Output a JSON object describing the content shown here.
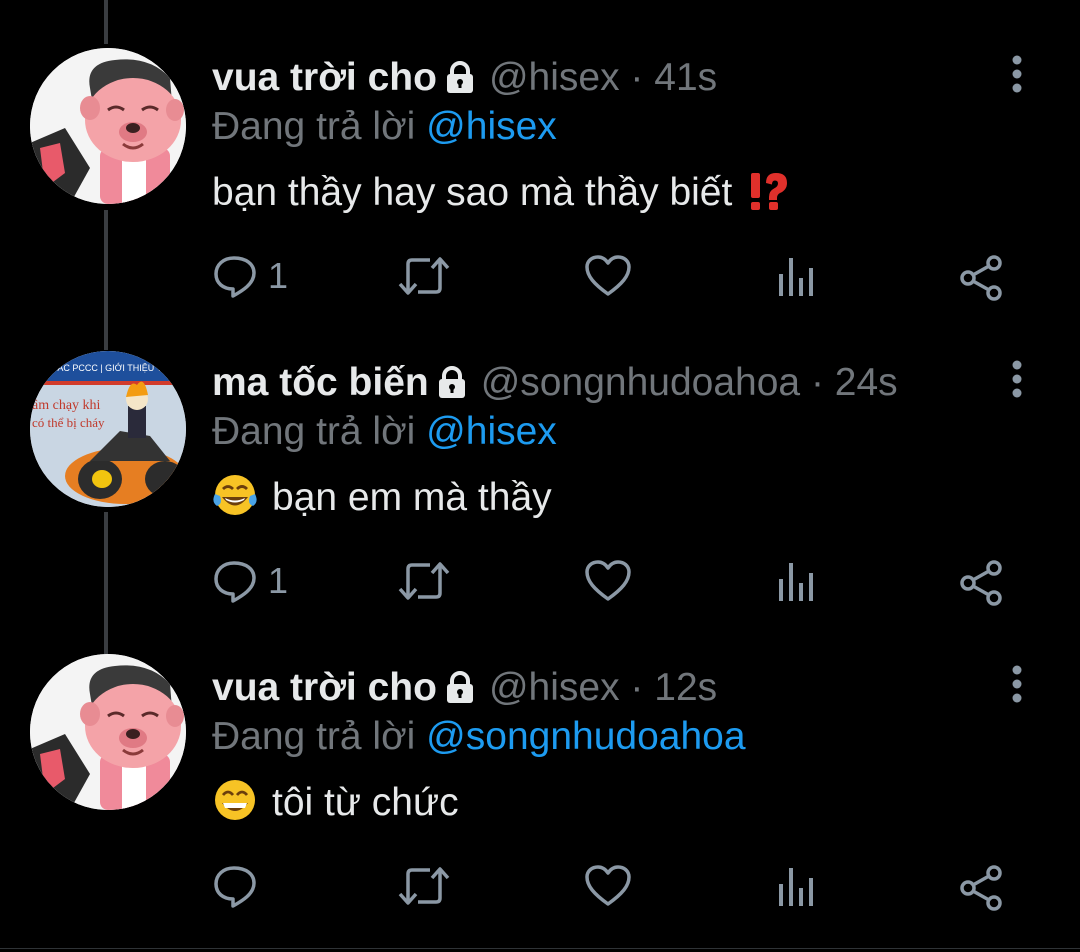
{
  "tweets": [
    {
      "name": "vua trời cho",
      "handle": "@hisex",
      "separator": "·",
      "time": "41s",
      "reply_prefix": "Đang trả lời",
      "reply_mention": "@hisex",
      "emoji_before": "",
      "emoji_after": "exclamation-question-icon",
      "text": "bạn thầy hay sao mà thầy biết",
      "reply_count": "1",
      "avatar": "cartoon-bear-avatar"
    },
    {
      "name": "ma tốc biến",
      "handle": "@songnhudoahoa",
      "separator": "·",
      "time": "24s",
      "reply_prefix": "Đang trả lời",
      "reply_mention": "@hisex",
      "emoji_before": "tears-of-joy-emoji",
      "emoji_after": "",
      "text": "bạn em mà thầy",
      "reply_count": "1",
      "avatar": "ghost-rider-avatar",
      "avatar_text": [
        "NG TÁC PCCC | GIỚI THIỆU TH",
        "âm chạy khi",
        "có thể bị cháy"
      ]
    },
    {
      "name": "vua trời cho",
      "handle": "@hisex",
      "separator": "·",
      "time": "12s",
      "reply_prefix": "Đang trả lời",
      "reply_mention": "@songnhudoahoa",
      "emoji_before": "grinning-emoji",
      "emoji_after": "",
      "text": "tôi từ chức",
      "reply_count": "",
      "avatar": "cartoon-bear-avatar"
    }
  ],
  "colors": {
    "background": "#000000",
    "text": "#e7e9ea",
    "muted": "#71767b",
    "link": "#1d9bf0",
    "icon": "#8b98a5",
    "thread_line": "#3a3d41"
  }
}
